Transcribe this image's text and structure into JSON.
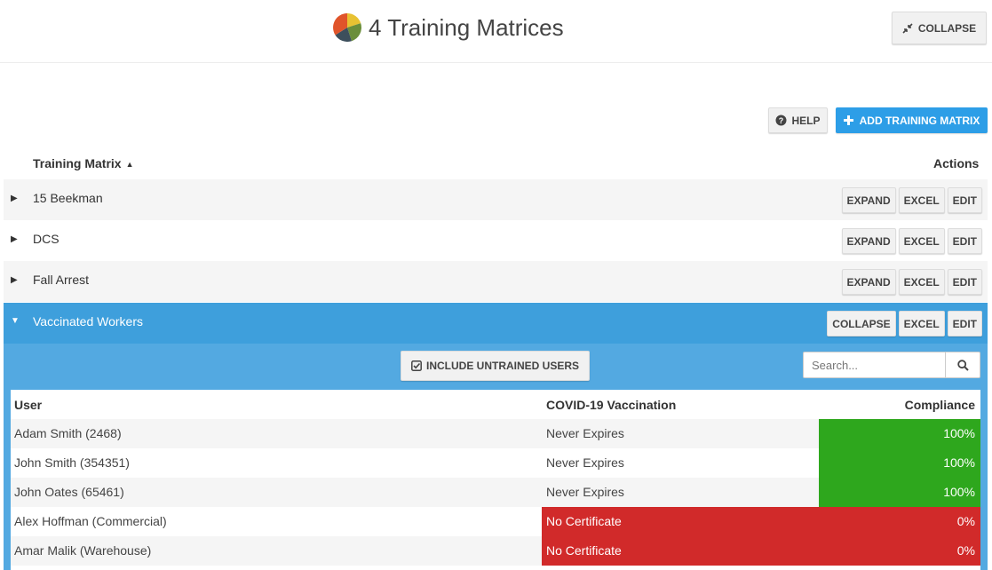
{
  "header": {
    "title": "4 Training Matrices",
    "collapse_label": "COLLAPSE"
  },
  "toolbar": {
    "help_label": "HELP",
    "add_label": "ADD TRAINING MATRIX"
  },
  "columns": {
    "matrix": "Training Matrix",
    "actions": "Actions"
  },
  "actions": {
    "expand": "EXPAND",
    "collapse": "COLLAPSE",
    "excel": "EXCEL",
    "edit": "EDIT"
  },
  "matrices": [
    {
      "name": "15 Beekman",
      "expanded": false
    },
    {
      "name": "DCS",
      "expanded": false
    },
    {
      "name": "Fall Arrest",
      "expanded": false
    },
    {
      "name": "Vaccinated Workers",
      "expanded": true
    }
  ],
  "detail": {
    "include_untrained_label": "INCLUDE UNTRAINED USERS",
    "search_placeholder": "Search...",
    "columns": [
      "User",
      "COVID-19 Vaccination",
      "Compliance"
    ],
    "rows": [
      {
        "user": "Adam Smith (2468)",
        "vaccination": "Never Expires",
        "compliance": "100%",
        "status": "ok"
      },
      {
        "user": "John Smith (354351)",
        "vaccination": "Never Expires",
        "compliance": "100%",
        "status": "ok"
      },
      {
        "user": "John Oates (65461)",
        "vaccination": "Never Expires",
        "compliance": "100%",
        "status": "ok"
      },
      {
        "user": "Alex Hoffman (Commercial)",
        "vaccination": "No Certificate",
        "compliance": "0%",
        "status": "missing"
      },
      {
        "user": "Amar Malik (Warehouse)",
        "vaccination": "No Certificate",
        "compliance": "0%",
        "status": "missing"
      }
    ]
  },
  "colors": {
    "accent": "#2d9ee7",
    "active_row": "#3e9fdc",
    "panel": "#53a9e1",
    "compliant": "#2ea71d",
    "noncompliant": "#d12a2a"
  },
  "icons": {
    "title": "pie-chart-icon",
    "collapse": "compress-icon",
    "help": "question-circle-icon",
    "add": "plus-icon",
    "untrained": "check-square-icon",
    "search": "search-icon",
    "expand_caret": "caret-right-icon",
    "collapse_caret": "caret-down-icon"
  }
}
